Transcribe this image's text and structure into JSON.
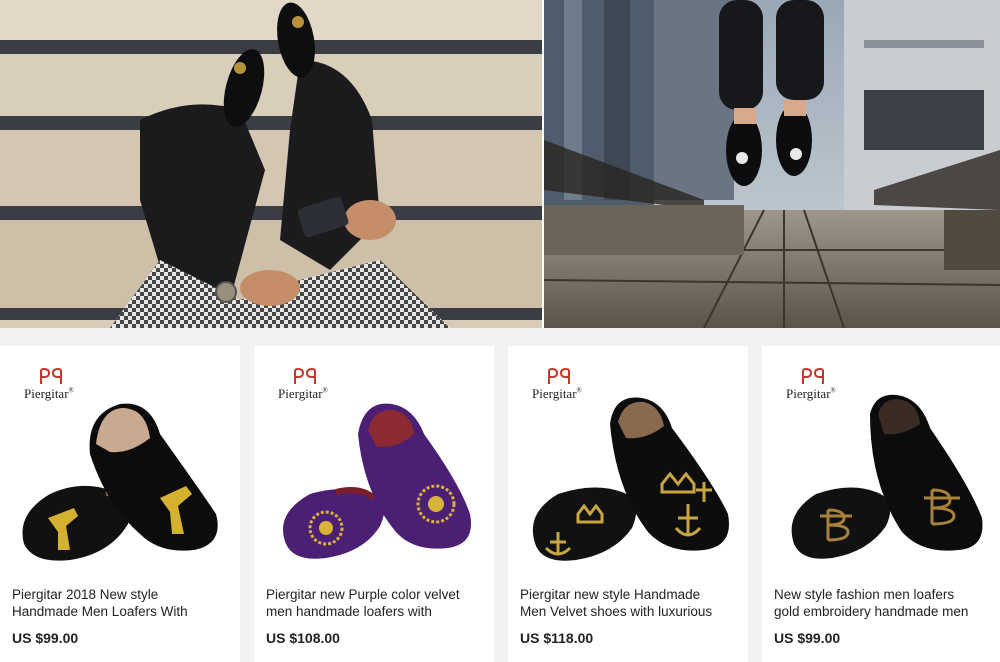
{
  "products": [
    {
      "brand": "Piergitar",
      "brand_mark": "®",
      "title_line1": "Piergitar 2018 New style",
      "title_line2": "Handmade Men Loafers With",
      "price": "US $99.00",
      "shoe_color": "#111111",
      "embroidery_color": "#d4b12e"
    },
    {
      "brand": "Piergitar",
      "brand_mark": "®",
      "title_line1": "Piergitar new Purple color velvet",
      "title_line2": "men handmade loafers with",
      "price": "US $108.00",
      "shoe_color": "#4b1f73",
      "embroidery_color": "#d8b23a"
    },
    {
      "brand": "Piergitar",
      "brand_mark": "®",
      "title_line1": "Piergitar new style Handmade",
      "title_line2": "Men Velvet shoes with luxurious",
      "price": "US $118.00",
      "shoe_color": "#111111",
      "embroidery_color": "#c9a640"
    },
    {
      "brand": "Piergitar",
      "brand_mark": "®",
      "title_line1": "New style fashion men loafers",
      "title_line2": "gold embroidery handmade men",
      "price": "US $99.00",
      "shoe_color": "#111111",
      "embroidery_color": "#a8813a"
    }
  ],
  "colors": {
    "brand_logo": "#c0392b",
    "page_background": "#f2f2f2",
    "card_background": "#ffffff",
    "text": "#222222"
  },
  "hero": {
    "left_photo": "man-on-stairs-wearing-loafers",
    "right_photo": "man-jumping-on-boardwalk"
  }
}
